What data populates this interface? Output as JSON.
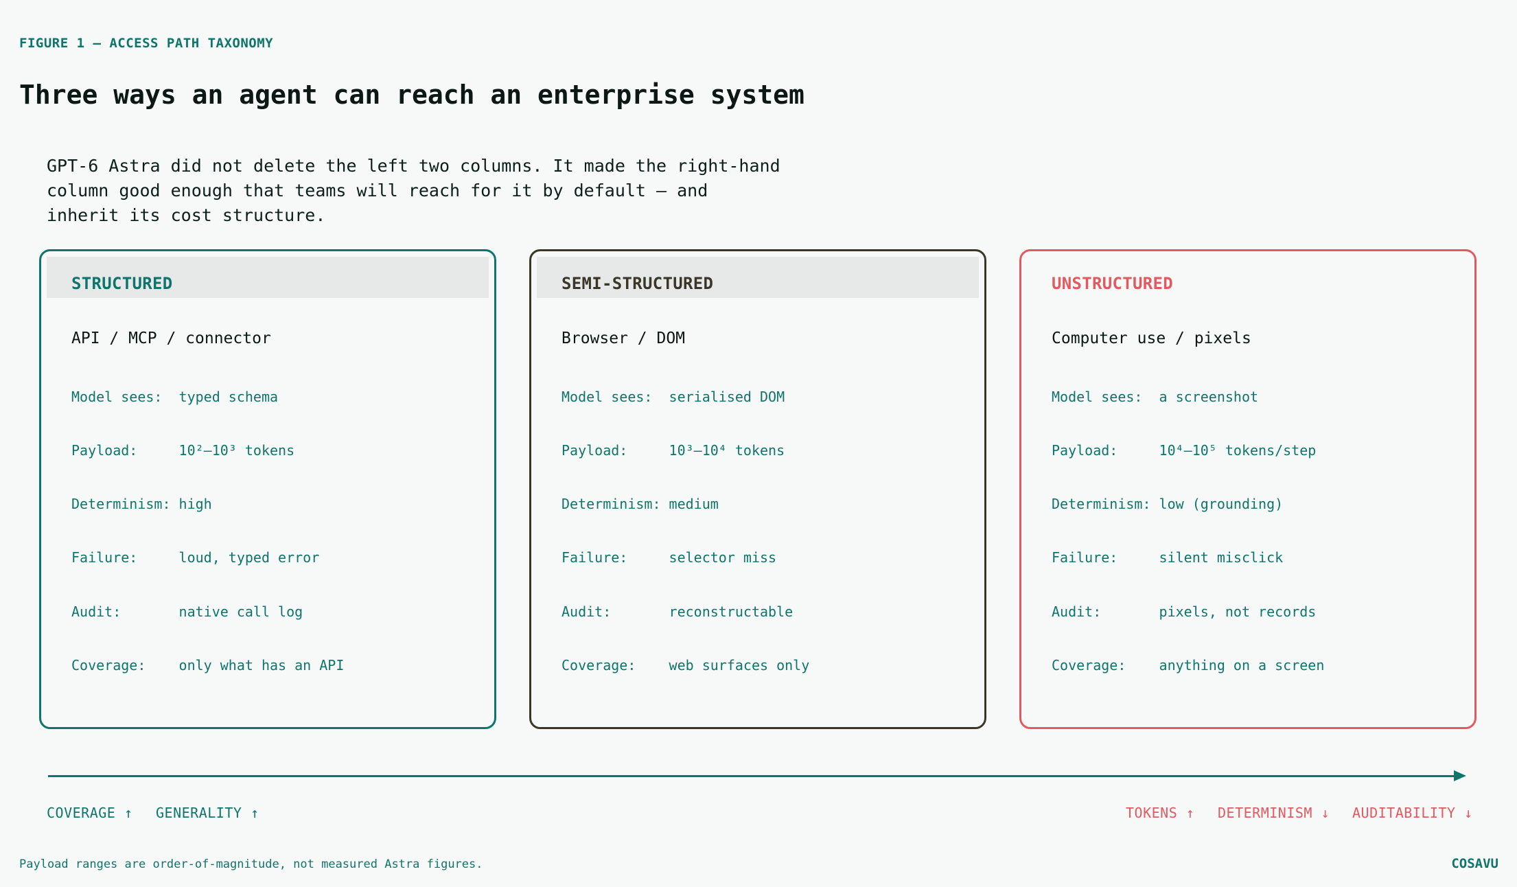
{
  "figure": {
    "eyebrow": "FIGURE 1 — ACCESS PATH TAXONOMY",
    "title": "Three ways an agent can reach an enterprise system",
    "intro": "GPT-6 Astra did not delete the left two columns. It made the right-hand column good enough that teams will reach for it by default — and inherit its cost structure."
  },
  "colors": {
    "teal": "#0f746c",
    "dark": "#3b3628",
    "red": "#e05a60",
    "background": "#f6f9f8"
  },
  "cards": [
    {
      "label": "STRUCTURED",
      "subtitle": "API / MCP / connector",
      "rows": [
        {
          "key": "Model sees:  ",
          "value": "typed schema"
        },
        {
          "key": "Payload:     ",
          "value": "10²–10³ tokens"
        },
        {
          "key": "Determinism: ",
          "value": "high"
        },
        {
          "key": "Failure:     ",
          "value": "loud, typed error"
        },
        {
          "key": "Audit:       ",
          "value": "native call log"
        },
        {
          "key": "Coverage:    ",
          "value": "only what has an API"
        }
      ]
    },
    {
      "label": "SEMI-STRUCTURED",
      "subtitle": "Browser / DOM",
      "rows": [
        {
          "key": "Model sees:  ",
          "value": "serialised DOM"
        },
        {
          "key": "Payload:     ",
          "value": "10³–10⁴ tokens"
        },
        {
          "key": "Determinism: ",
          "value": "medium"
        },
        {
          "key": "Failure:     ",
          "value": "selector miss"
        },
        {
          "key": "Audit:       ",
          "value": "reconstructable"
        },
        {
          "key": "Coverage:    ",
          "value": "web surfaces only"
        }
      ]
    },
    {
      "label": "UNSTRUCTURED",
      "subtitle": "Computer use / pixels",
      "rows": [
        {
          "key": "Model sees:  ",
          "value": "a screenshot"
        },
        {
          "key": "Payload:     ",
          "value": "10⁴–10⁵ tokens/step"
        },
        {
          "key": "Determinism: ",
          "value": "low (grounding)"
        },
        {
          "key": "Failure:     ",
          "value": "silent misclick"
        },
        {
          "key": "Audit:       ",
          "value": "pixels, not records"
        },
        {
          "key": "Coverage:    ",
          "value": "anything on a screen"
        }
      ]
    }
  ],
  "axis": {
    "left_labels": [
      "COVERAGE ↑",
      "GENERALITY ↑"
    ],
    "right_labels": [
      "TOKENS ↑",
      "DETERMINISM ↓",
      "AUDITABILITY ↓"
    ]
  },
  "footnote": "Payload ranges are order-of-magnitude, not measured Astra figures.",
  "brand": "COSAVU"
}
